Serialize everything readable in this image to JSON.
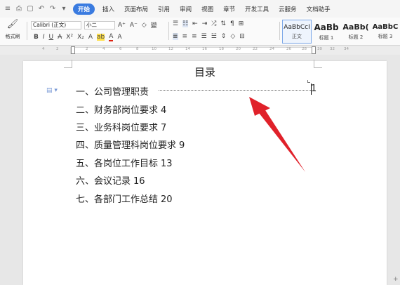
{
  "menubar": {
    "items": [
      "开始",
      "插入",
      "页面布局",
      "引用",
      "审阅",
      "视图",
      "章节",
      "开发工具",
      "云服务",
      "文档助手"
    ],
    "active_index": 0
  },
  "ribbon": {
    "format_painter_label": "格式刷",
    "font_name": "Calibri (正文)",
    "font_size": "小二",
    "row1_buttons": [
      "A⁺",
      "A⁻",
      "◇",
      "變"
    ],
    "row2_buttons": [
      "B",
      "I",
      "U",
      "A",
      "X²",
      "X₂",
      "A",
      "ab",
      "A",
      "A"
    ],
    "styles": [
      {
        "preview": "AaBbCcI",
        "name": "正文"
      },
      {
        "preview": "AaBb",
        "name": "标题 1"
      },
      {
        "preview": "AaBb(",
        "name": "标题 2"
      },
      {
        "preview": "AaBbC",
        "name": "标题 3"
      }
    ]
  },
  "ruler": {
    "ticks": [
      "4",
      "2",
      "2",
      "4",
      "6",
      "8",
      "10",
      "12",
      "14",
      "16",
      "18",
      "20",
      "22",
      "24",
      "26",
      "28",
      "30",
      "32",
      "34"
    ]
  },
  "document": {
    "title": "目录",
    "toc": [
      {
        "text": "一、公司管理职责",
        "page": "1"
      },
      {
        "text": "二、财务部岗位要求",
        "page": "4"
      },
      {
        "text": "三、业务科岗位要求",
        "page": "7"
      },
      {
        "text": "四、质量管理科岗位要求",
        "page": "9"
      },
      {
        "text": "五、各岗位工作目标",
        "page": "13"
      },
      {
        "text": "六、会议记录",
        "page": "16"
      },
      {
        "text": "七、各部门工作总结",
        "page": "20"
      }
    ]
  },
  "colors": {
    "accent": "#3a7be0",
    "arrow": "#e0212a"
  }
}
